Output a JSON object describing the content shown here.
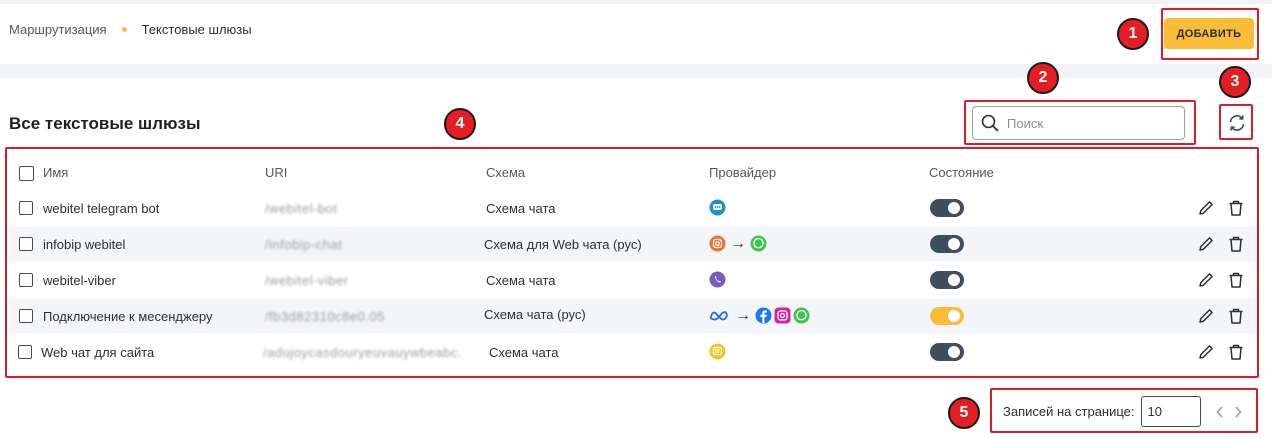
{
  "breadcrumb": {
    "root": "Маршрутизация",
    "current": "Текстовые шлюзы"
  },
  "toolbar": {
    "add_label": "ДОБАВИТЬ"
  },
  "section": {
    "title": "Все текстовые шлюзы"
  },
  "search": {
    "placeholder": "Поиск",
    "value": ""
  },
  "table": {
    "headers": {
      "name": "Имя",
      "uri": "URI",
      "schema": "Схема",
      "provider": "Провайдер",
      "state": "Состояние"
    },
    "rows": [
      {
        "name": "webitel telegram bot",
        "uri": "/webitel-bot",
        "schema": "Схема чата",
        "providers": [
          "chat-bubble-icon"
        ],
        "enabled": false
      },
      {
        "name": "infobip webitel",
        "uri": "/infobip-chat",
        "schema": "Схема для Web чата (рус)",
        "providers": [
          "instagram-icon",
          "whatsapp-icon"
        ],
        "enabled": false
      },
      {
        "name": "webitel-viber",
        "uri": "/webitel-viber",
        "schema": "Схема чата",
        "providers": [
          "viber-icon"
        ],
        "enabled": false
      },
      {
        "name": "Подключение к месенджеру",
        "uri": "/fb3d82310c8e0.05",
        "schema": "Схема чата (рус)",
        "providers": [
          "meta-icon",
          "facebook-icon",
          "instagram-icon",
          "whatsapp-icon"
        ],
        "enabled": true
      },
      {
        "name": "Web чат для сайта",
        "uri": "/adujoycasdouryeuvauywbeabc.",
        "schema": "Схема чата",
        "providers": [
          "webchat-icon"
        ],
        "enabled": false
      }
    ]
  },
  "pagination": {
    "label": "Записей на странице:",
    "size": "10"
  },
  "annotations": [
    "1",
    "2",
    "3",
    "4",
    "5"
  ],
  "colors": {
    "accent": "#fbbc38",
    "annotation": "#d4202a",
    "toggle_off": "#3d4e5c"
  }
}
